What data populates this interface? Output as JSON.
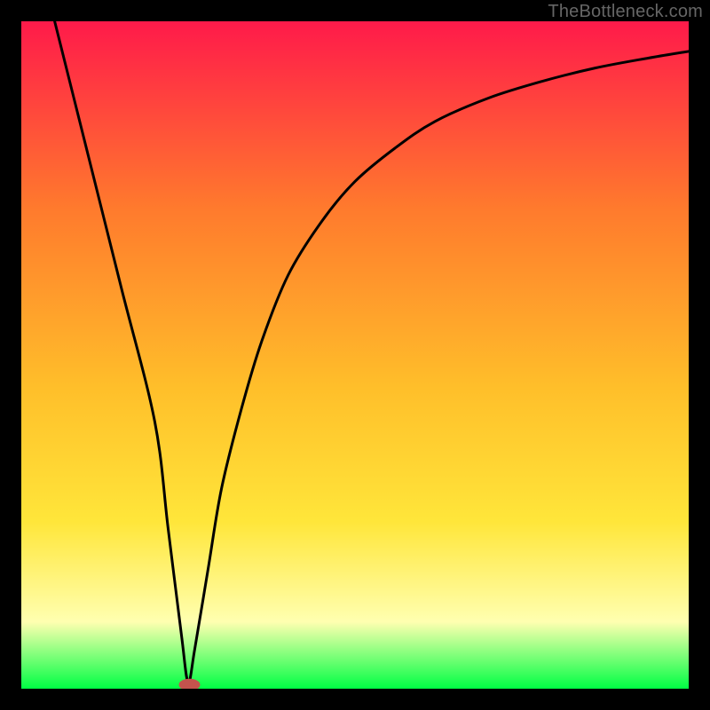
{
  "watermark": "TheBottleneck.com",
  "chart_data": {
    "type": "line",
    "title": "",
    "xlabel": "",
    "ylabel": "",
    "xlim": [
      0,
      100
    ],
    "ylim": [
      0,
      100
    ],
    "gradient_colors": {
      "top": "#ff1a4a",
      "upper_mid": "#ff7a2d",
      "mid": "#ffbf2a",
      "lower_mid": "#ffe63a",
      "pale": "#ffffb0",
      "bottom": "#00ff44"
    },
    "background": "#000000",
    "series": [
      {
        "name": "bottleneck-curve",
        "type": "line",
        "color": "#000000",
        "x": [
          5,
          10,
          15,
          20,
          22,
          24,
          25,
          26,
          28,
          30,
          33,
          36,
          40,
          45,
          50,
          56,
          62,
          70,
          78,
          86,
          94,
          100
        ],
        "y": [
          100,
          80,
          60,
          40,
          24,
          8,
          1,
          6,
          18,
          30,
          42,
          52,
          62,
          70,
          76,
          81,
          85,
          88.5,
          91,
          93,
          94.5,
          95.5
        ]
      }
    ],
    "marker": {
      "name": "optimum-point",
      "x": 25.2,
      "y": 0.6,
      "rx": 1.6,
      "ry": 0.9,
      "color": "#c4534d"
    }
  }
}
